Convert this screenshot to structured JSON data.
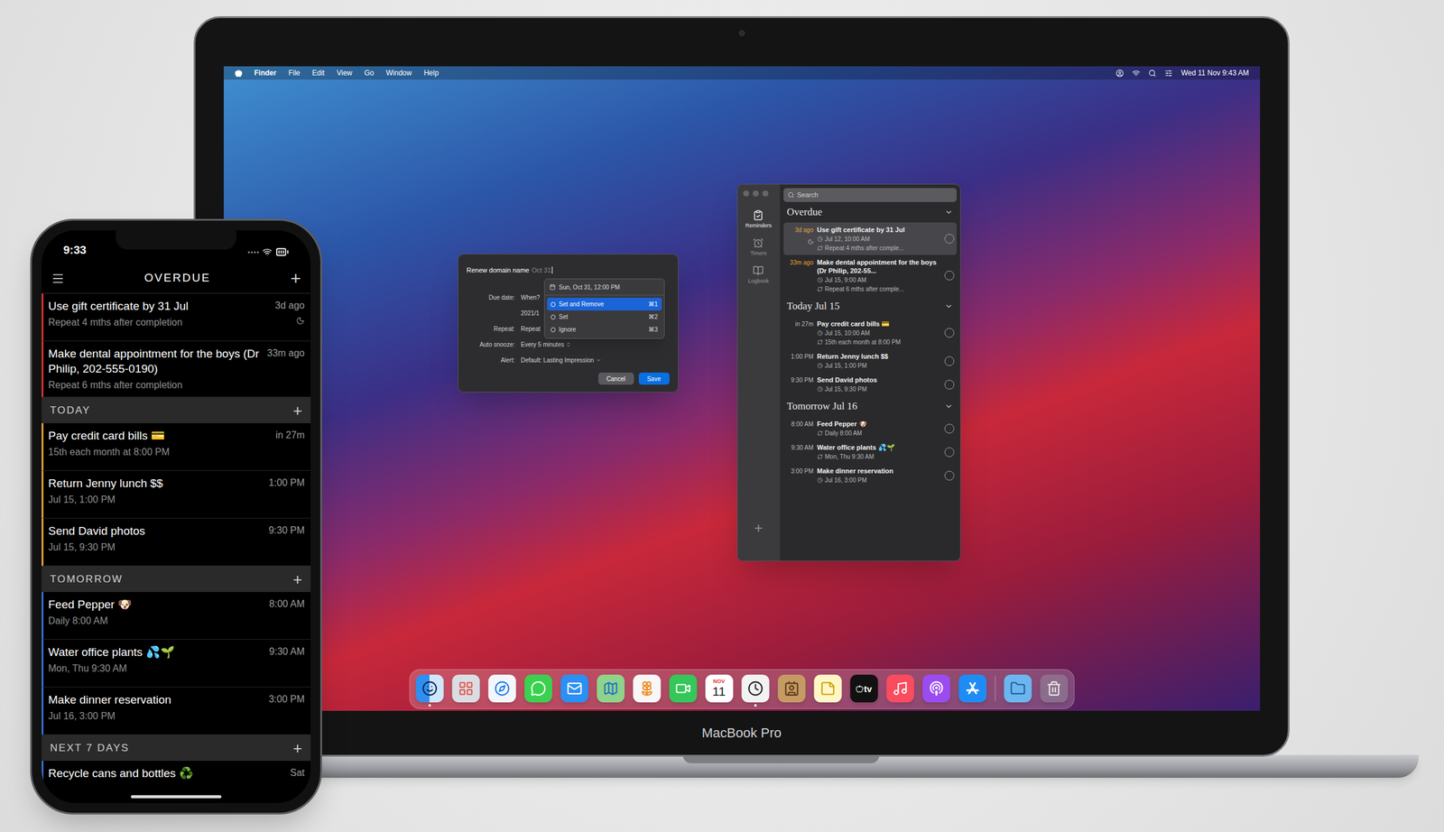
{
  "laptop": {
    "label": "MacBook Pro"
  },
  "menu_bar": {
    "app": "Finder",
    "items": [
      "File",
      "Edit",
      "View",
      "Go",
      "Window",
      "Help"
    ],
    "clock": "Wed 11 Nov 9:43 AM"
  },
  "dialog": {
    "title": "Renew domain name",
    "title_hint": "Oct 31",
    "fields": [
      {
        "label": "Due date:",
        "value": "When?",
        "kind": "text"
      },
      {
        "value": "2021/1",
        "kind": "text"
      },
      {
        "label": "Repeat:",
        "value": "Repeat",
        "kind": "text"
      },
      {
        "label": "Auto snooze:",
        "value": "Every 5 minutes",
        "kind": "stepper"
      },
      {
        "label": "Alert:",
        "value": "Default: Lasting Impression",
        "kind": "popup"
      }
    ],
    "suggestion": "Sun, Oct 31, 12:00 PM",
    "options": [
      {
        "label": "Set and Remove",
        "shortcut": "⌘1",
        "selected": true
      },
      {
        "label": "Set",
        "shortcut": "⌘2",
        "selected": false
      },
      {
        "label": "Ignore",
        "shortcut": "⌘3",
        "selected": false
      }
    ],
    "buttons": [
      {
        "label": "Cancel",
        "primary": false
      },
      {
        "label": "Save",
        "primary": true
      }
    ]
  },
  "app_window": {
    "search": {
      "placeholder": "Search"
    },
    "sidebar": [
      {
        "label": "Reminders",
        "selected": true
      },
      {
        "label": "Timers",
        "selected": false
      },
      {
        "label": "Logbook",
        "selected": false
      }
    ],
    "add": "+",
    "sections": [
      {
        "title": "Overdue",
        "expanded": true,
        "color": "#e3a33b",
        "items": [
          {
            "time": "3d ago",
            "title": "Use gift certificate by 31 Jul",
            "date": "Jul 12, 10:00 AM",
            "repeat": "Repeat 4 mths after comple...",
            "snoozed": true,
            "selected": true
          },
          {
            "time": "33m ago",
            "title": "Make dental appointment for the boys (Dr Philip, 202-55...",
            "date": "Jul 15, 9:00 AM",
            "repeat": "Repeat 6 mths after comple...",
            "snoozed": false,
            "selected": false
          }
        ]
      },
      {
        "title": "Today Jul 15",
        "expanded": true,
        "color": "#bdbdbd",
        "items": [
          {
            "time": "in 27m",
            "title": "Pay credit card bills 💳",
            "date": "Jul 15, 10:00 AM",
            "repeat": "15th each month at 8:00 PM",
            "snoozed": false,
            "selected": false
          },
          {
            "time": "1:00 PM",
            "title": "Return Jenny lunch $$",
            "date": "Jul 15, 1:00 PM",
            "snoozed": false,
            "selected": false
          },
          {
            "time": "9:30 PM",
            "title": "Send David photos",
            "date": "Jul 15, 9:30 PM",
            "snoozed": false,
            "selected": false
          }
        ]
      },
      {
        "title": "Tomorrow Jul 16",
        "expanded": true,
        "color": "#bdbdbd",
        "items": [
          {
            "time": "8:00 AM",
            "title": "Feed Pepper 🐶",
            "repeat": "Daily 8:00 AM",
            "snoozed": false,
            "selected": false
          },
          {
            "time": "9:30 AM",
            "title": "Water office plants 💦🌱",
            "repeat": "Mon, Thu 9:30 AM",
            "snoozed": false,
            "selected": false
          },
          {
            "time": "3:00 PM",
            "title": "Make dinner reservation",
            "date": "Jul 16, 3:00 PM",
            "snoozed": false,
            "selected": false
          }
        ]
      }
    ]
  },
  "dock": {
    "apps": [
      {
        "kind": "finder",
        "running": true
      },
      {
        "kind": "launchpad",
        "running": false
      },
      {
        "kind": "safari",
        "running": false
      },
      {
        "kind": "messages",
        "running": false
      },
      {
        "kind": "mail",
        "running": false
      },
      {
        "kind": "maps",
        "running": false
      },
      {
        "kind": "photos",
        "running": false
      },
      {
        "kind": "facetime",
        "running": false
      },
      {
        "kind": "calendar",
        "running": false,
        "month": "NOV",
        "day": "11"
      },
      {
        "kind": "reminders",
        "running": true
      },
      {
        "kind": "contacts",
        "running": false
      },
      {
        "kind": "notes",
        "running": false
      },
      {
        "kind": "tv",
        "running": false,
        "label": "tv"
      },
      {
        "kind": "music",
        "running": false
      },
      {
        "kind": "podcasts",
        "running": false
      },
      {
        "kind": "appstore",
        "running": false
      }
    ],
    "stacks": [
      {
        "kind": "downloads",
        "running": false
      },
      {
        "kind": "trash",
        "running": false
      }
    ]
  },
  "phone": {
    "status_time": "9:33",
    "header": {
      "title": "OVERDUE",
      "add": "+"
    },
    "overdue": {
      "color": "#d8342c",
      "items": [
        {
          "title": "Use gift certificate by 31 Jul",
          "subtitle": "Repeat 4 mths after completion",
          "time": "3d ago",
          "snoozed": true
        },
        {
          "title": "Make dental appointment for the boys (Dr Philip, 202-555-0190)",
          "subtitle": "Repeat 6 mths after completion",
          "time": "33m ago",
          "snoozed": false
        }
      ]
    },
    "sections": [
      {
        "title": "TODAY",
        "add": "+",
        "color": "#e8a23a",
        "items": [
          {
            "title": "Pay credit card bills 💳",
            "subtitle": "15th each month at 8:00 PM",
            "time": "in 27m",
            "snoozed": false
          },
          {
            "title": "Return Jenny lunch $$",
            "subtitle": "Jul 15, 1:00 PM",
            "time": "1:00 PM",
            "snoozed": false
          },
          {
            "title": "Send David photos",
            "subtitle": "Jul 15, 9:30 PM",
            "time": "9:30 PM",
            "snoozed": false
          }
        ]
      },
      {
        "title": "TOMORROW",
        "add": "+",
        "color": "#3b6fd4",
        "items": [
          {
            "title": "Feed Pepper 🐶",
            "subtitle": "Daily 8:00 AM",
            "time": "8:00 AM",
            "snoozed": false
          },
          {
            "title": "Water office plants 💦🌱",
            "subtitle": "Mon, Thu 9:30 AM",
            "time": "9:30 AM",
            "snoozed": false
          },
          {
            "title": "Make dinner reservation",
            "subtitle": "Jul 16, 3:00 PM",
            "time": "3:00 PM",
            "snoozed": false
          }
        ]
      },
      {
        "title": "NEXT 7 DAYS",
        "add": "+",
        "color": "#3b6fd4",
        "items": [
          {
            "title": "Recycle cans and bottles ♻️",
            "time": "Sat",
            "snoozed": false
          }
        ]
      }
    ]
  }
}
